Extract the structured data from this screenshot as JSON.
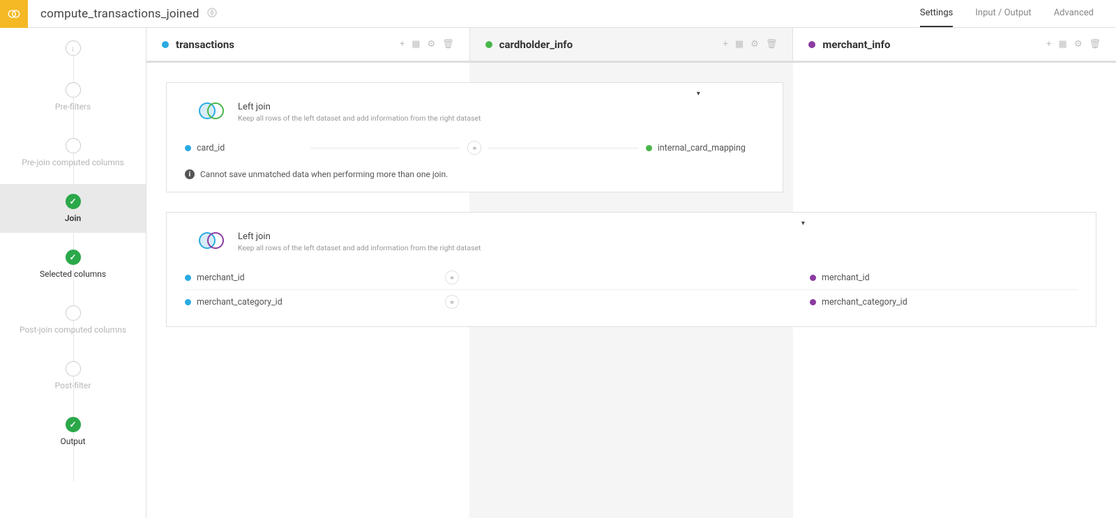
{
  "header": {
    "title": "compute_transactions_joined",
    "tabs": [
      "Settings",
      "Input / Output",
      "Advanced"
    ],
    "active_tab": 0
  },
  "steps": [
    {
      "label": "",
      "state": "arrow"
    },
    {
      "label": "Pre-filters",
      "state": "empty"
    },
    {
      "label": "Pre-join computed columns",
      "state": "empty"
    },
    {
      "label": "Join",
      "state": "ok",
      "active": true
    },
    {
      "label": "Selected columns",
      "state": "ok"
    },
    {
      "label": "Post-join computed columns",
      "state": "empty"
    },
    {
      "label": "Post-filter",
      "state": "empty"
    },
    {
      "label": "Output",
      "state": "ok"
    }
  ],
  "datasets": [
    {
      "name": "transactions",
      "color": "#29AAE1"
    },
    {
      "name": "cardholder_info",
      "color": "#49B649"
    },
    {
      "name": "merchant_info",
      "color": "#8B3AA1"
    }
  ],
  "ds_action_icons": {
    "add": "+",
    "table": "▦",
    "gear": "⚙",
    "trash": "🗑"
  },
  "joins": [
    {
      "type": "Left join",
      "desc": "Keep all rows of the left dataset and add information from the right dataset",
      "left_color": "#29AAE1",
      "right_color": "#49B649",
      "note": "Cannot save unmatched data when performing more than one join.",
      "conditions": [
        {
          "left": "card_id",
          "left_color": "#29AAE1",
          "op": "=",
          "right": "internal_card_mapping",
          "right_color": "#49B649",
          "right_pos": "mid"
        }
      ]
    },
    {
      "type": "Left join",
      "desc": "Keep all rows of the left dataset and add information from the right dataset",
      "left_color": "#29AAE1",
      "right_color": "#8B3AA1",
      "conditions": [
        {
          "left": "merchant_id",
          "left_color": "#29AAE1",
          "op": "=",
          "right": "merchant_id",
          "right_color": "#8B3AA1",
          "right_pos": "right"
        },
        {
          "left": "merchant_category_id",
          "left_color": "#29AAE1",
          "op": "=",
          "right": "merchant_category_id",
          "right_color": "#8B3AA1",
          "right_pos": "right"
        }
      ]
    }
  ]
}
